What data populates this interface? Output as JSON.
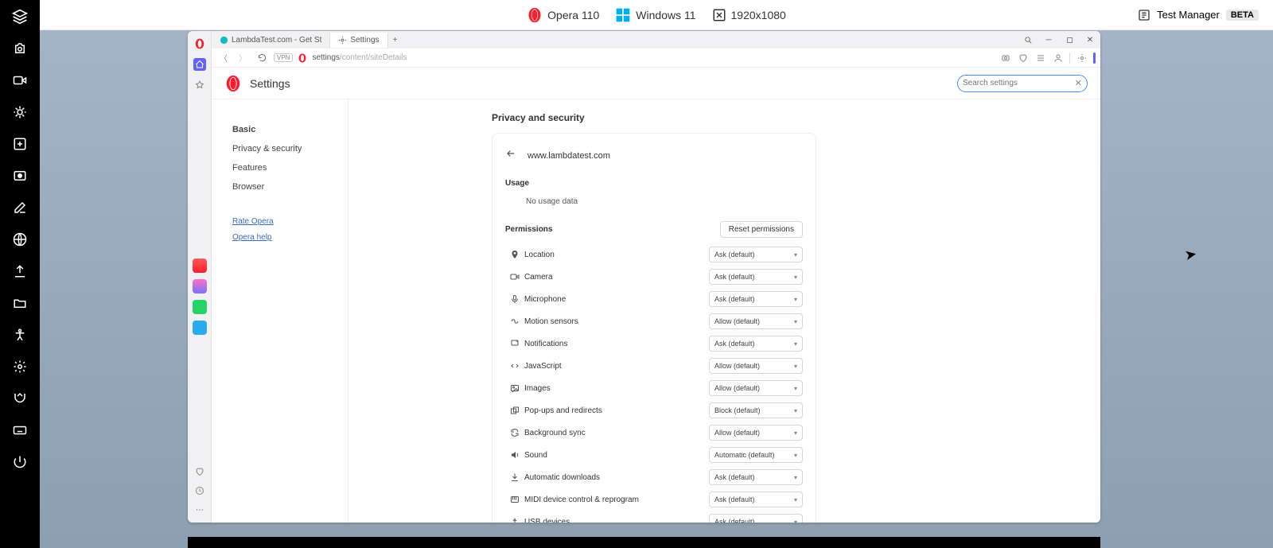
{
  "topbar": {
    "browser_label": "Opera 110",
    "os_label": "Windows 11",
    "resolution": "1920x1080",
    "test_manager": "Test Manager",
    "beta": "BETA"
  },
  "tabs": [
    {
      "label": "LambdaTest.com - Get St"
    },
    {
      "label": "Settings"
    }
  ],
  "addr": {
    "vpn": "VPN",
    "url_prefix": "settings",
    "url_rest": "/content/siteDetails"
  },
  "settings": {
    "title": "Settings",
    "search_placeholder": "Search settings",
    "nav": {
      "items": [
        "Basic",
        "Privacy & security",
        "Features",
        "Browser"
      ],
      "rate": "Rate Opera",
      "help": "Opera help"
    },
    "section_title": "Privacy and security",
    "site": "www.lambdatest.com",
    "usage_label": "Usage",
    "usage_empty": "No usage data",
    "permissions_label": "Permissions",
    "reset_label": "Reset permissions",
    "perms": [
      {
        "icon": "location",
        "label": "Location",
        "value": "Ask (default)"
      },
      {
        "icon": "camera",
        "label": "Camera",
        "value": "Ask (default)"
      },
      {
        "icon": "mic",
        "label": "Microphone",
        "value": "Ask (default)"
      },
      {
        "icon": "motion",
        "label": "Motion sensors",
        "value": "Allow (default)"
      },
      {
        "icon": "notif",
        "label": "Notifications",
        "value": "Ask (default)"
      },
      {
        "icon": "js",
        "label": "JavaScript",
        "value": "Allow (default)"
      },
      {
        "icon": "images",
        "label": "Images",
        "value": "Allow (default)"
      },
      {
        "icon": "popups",
        "label": "Pop-ups and redirects",
        "value": "Block (default)"
      },
      {
        "icon": "sync",
        "label": "Background sync",
        "value": "Allow (default)"
      },
      {
        "icon": "sound",
        "label": "Sound",
        "value": "Automatic (default)"
      },
      {
        "icon": "download",
        "label": "Automatic downloads",
        "value": "Ask (default)"
      },
      {
        "icon": "midi",
        "label": "MIDI device control & reprogram",
        "value": "Ask (default)"
      },
      {
        "icon": "usb",
        "label": "USB devices",
        "value": "Ask (default)"
      }
    ]
  }
}
